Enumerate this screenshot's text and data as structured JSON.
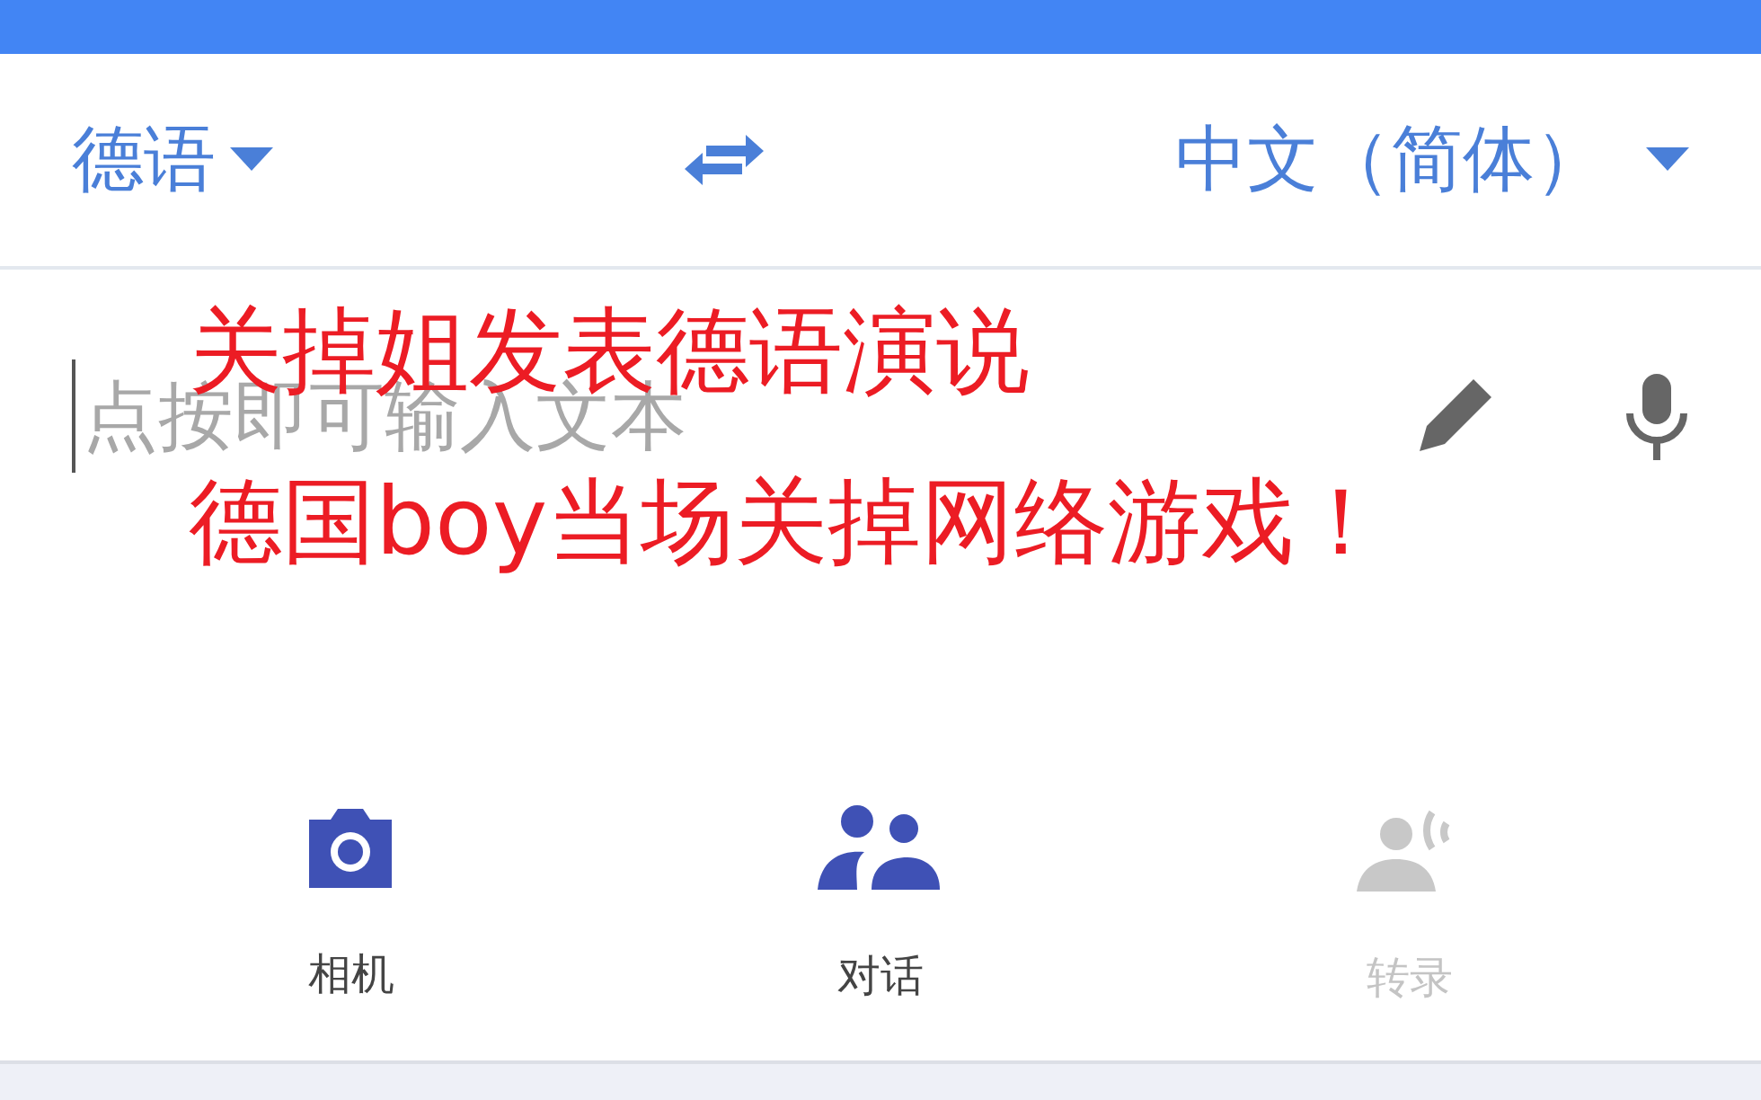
{
  "languages": {
    "source": "德语",
    "target": "中文（简体）"
  },
  "input": {
    "placeholder": "点按即可输入文本"
  },
  "modes": [
    {
      "kind": "camera",
      "label": "相机",
      "disabled": false
    },
    {
      "kind": "conversation",
      "label": "对话",
      "disabled": false
    },
    {
      "kind": "transcribe",
      "label": "转录",
      "disabled": true
    }
  ],
  "caption": [
    "关掉姐发表德语演说",
    "德国boy当场关掉网络游戏！"
  ]
}
